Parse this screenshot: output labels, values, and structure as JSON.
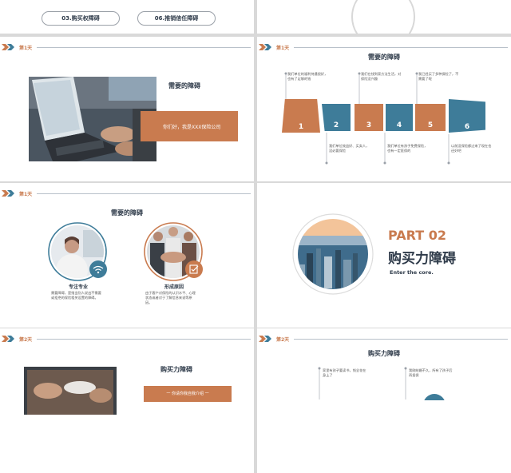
{
  "colors": {
    "orange": "#c97b4f",
    "blue": "#3e7c99",
    "navy": "#2f3b4a",
    "line": "#b9c1ca"
  },
  "slide1": {
    "pills": [
      "03.购买权障碍",
      "06.推销信任障碍"
    ]
  },
  "slide3": {
    "day": "第1天",
    "title": "需要的障碍",
    "banner": "你们好，我是XXX保险公司"
  },
  "slide4": {
    "day": "第1天",
    "title": "需要的障碍",
    "numbers": [
      "1",
      "2",
      "3",
      "4",
      "5",
      "6"
    ],
    "top_texts": [
      "我们单位的福利待遇很好，也有了足够的钱",
      "我们在钱到家方法生活，对保险没兴趣",
      "我已经买了多种保险了，不需要了呢"
    ],
    "bottom_texts": [
      "我们单位效益好、买卖人，没必要保险",
      "我们单位有孩子免费保险，也有一定医保的",
      "以前没保险都过来了现在也还好吧"
    ]
  },
  "slide5": {
    "day": "第1天",
    "title": "需要的障碍",
    "left_label": "专注专业",
    "left_desc": "需要障碍，是指当别人说出不需要或拒绝的保险相关设置的障碍。",
    "right_label": "形成原因",
    "right_desc": "由于客户对保险的认识水平、心理状态或者对于了解信息来说等原因。"
  },
  "slide6": {
    "part": "PART 02",
    "title": "购买力障碍",
    "subtitle": "Enter the core."
  },
  "slide7": {
    "day": "第2天",
    "title": "购买力障碍",
    "banner": "一 你请你我自我介绍 一"
  },
  "slide8": {
    "day": "第2天",
    "title": "购买力障碍",
    "text_a": "家里有孩子要读书，钱全花在身上了",
    "text_b": "我刚结婚不久，所有了孩子后再投保"
  }
}
